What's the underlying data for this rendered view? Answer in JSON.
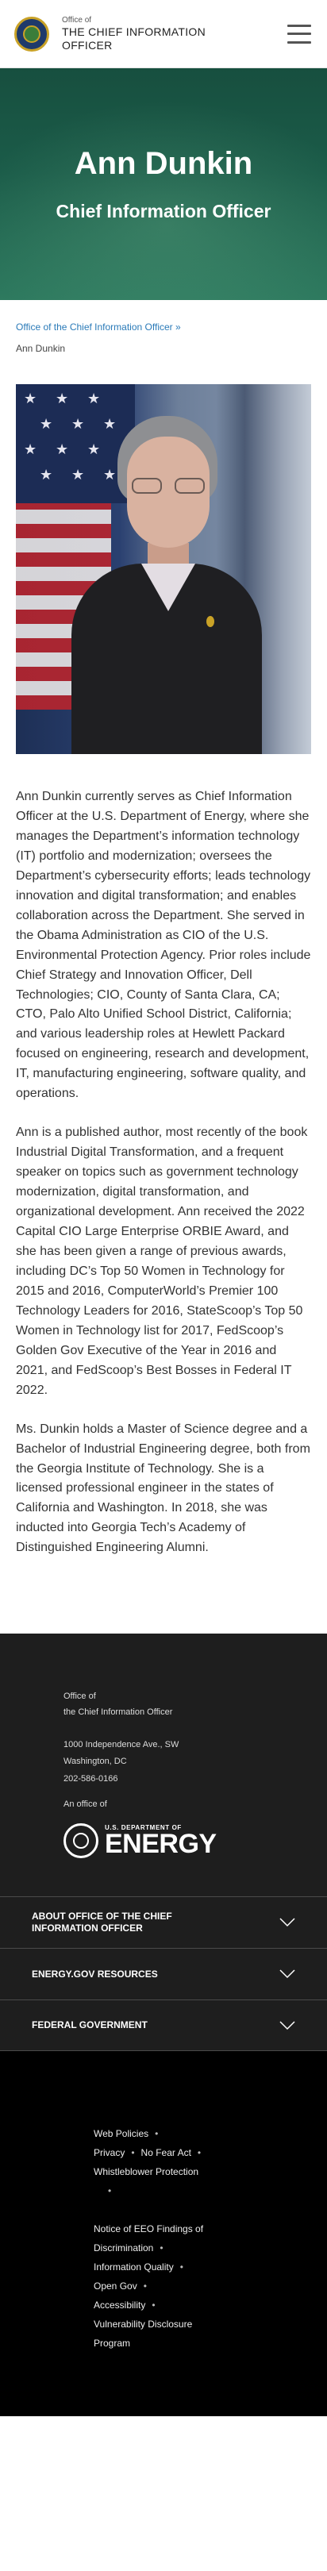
{
  "header": {
    "office_small": "Office of",
    "office_big_1": "THE CHIEF INFORMATION",
    "office_big_2": "OFFICER",
    "logo_icon": "doe-seal-icon",
    "menu_icon": "hamburger-menu-icon"
  },
  "hero": {
    "name": "Ann Dunkin",
    "title": "Chief Information Officer"
  },
  "breadcrumb": {
    "parent": "Office of the Chief Information Officer",
    "separator": "»",
    "current": "Ann Dunkin"
  },
  "bio": {
    "p1": "Ann Dunkin currently serves as Chief Information Officer at the U.S. Department of Energy, where she manages the Department’s information technology (IT) portfolio and modernization; oversees the Department’s cybersecurity efforts; leads technology innovation and digital transformation; and enables collaboration across the Department. She served in the Obama Administration as CIO of the U.S. Environmental Protection Agency. Prior roles include Chief Strategy and Innovation Officer, Dell Technologies; CIO, County of Santa Clara, CA; CTO, Palo Alto Unified School District, California; and various leadership roles at Hewlett Packard focused on engineering, research and development, IT, manufacturing engineering, software quality, and operations.",
    "p2": "Ann is a published author, most recently of the book Industrial Digital Transformation, and a frequent speaker on topics such as government technology modernization, digital transformation, and organizational development. Ann received the 2022 Capital CIO Large Enterprise ORBIE Award, and she has been given a range of previous awards, including DC’s Top 50 Women in Technology for 2015 and 2016, ComputerWorld’s Premier 100 Technology Leaders for 2016, StateScoop’s Top 50 Women in Technology list for 2017, FedScoop’s Golden Gov Executive of the Year in 2016 and 2021, and FedScoop’s Best Bosses in Federal IT 2022.",
    "p3": "Ms. Dunkin holds a Master of Science degree and a Bachelor of Industrial Engineering degree, both from the Georgia Institute of Technology. She is a licensed professional engineer in the states of California and Washington. In 2018, she was inducted into Georgia Tech’s Academy of Distinguished Engineering Alumni."
  },
  "footer": {
    "office_line1": "Office of",
    "office_line2": "the Chief Information Officer",
    "address_line1": "1000 Independence Ave., SW",
    "address_line2": "Washington, DC",
    "phone": "202-586-0166",
    "an_office_of": "An office of",
    "doe_small": "U.S. DEPARTMENT OF",
    "doe_big": "ENERGY",
    "accordion": [
      {
        "label": "ABOUT OFFICE OF THE CHIEF INFORMATION OFFICER",
        "icon": "chevron-down-icon"
      },
      {
        "label": "ENERGY.GOV RESOURCES",
        "icon": "chevron-down-icon"
      },
      {
        "label": "FEDERAL GOVERNMENT",
        "icon": "chevron-down-icon"
      }
    ],
    "legal": {
      "web_policies": "Web Policies",
      "privacy": "Privacy",
      "no_fear_act": "No Fear Act",
      "whistleblower": "Whistleblower Protection",
      "eeo_1": "Notice of EEO Findings of",
      "eeo_2": "Discrimination",
      "info_quality": "Information Quality",
      "open_gov": "Open Gov",
      "accessibility": "Accessibility",
      "vdp_1": "Vulnerability Disclosure",
      "vdp_2": "Program",
      "bullet": "•"
    }
  }
}
